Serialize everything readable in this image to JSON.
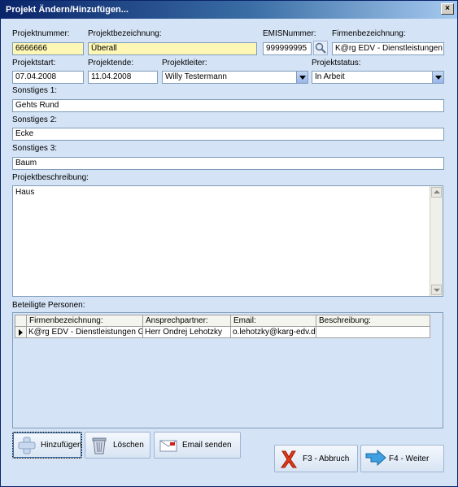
{
  "window": {
    "title": "Projekt Ändern/Hinzufügen...",
    "close": "×"
  },
  "fields": {
    "projektnummer": {
      "label": "Projektnummer:",
      "value": "6666666"
    },
    "projektbezeichnung": {
      "label": "Projektbezeichnung:",
      "value": "Überall"
    },
    "emisnummer": {
      "label": "EMISNummer:",
      "value": "999999995"
    },
    "firmenbezeichnung": {
      "label": "Firmenbezeichnung:",
      "value": "K@rg EDV - Dienstleistungen G"
    },
    "projektstart": {
      "label": "Projektstart:",
      "value": "07.04.2008"
    },
    "projektende": {
      "label": "Projektende:",
      "value": "11.04.2008"
    },
    "projektleiter": {
      "label": "Projektleiter:",
      "value": "Willy Testermann"
    },
    "projektstatus": {
      "label": "Projektstatus:",
      "value": "In Arbeit"
    },
    "sonstiges1": {
      "label": "Sonstiges 1:",
      "value": "Gehts Rund"
    },
    "sonstiges2": {
      "label": "Sonstiges 2:",
      "value": "Ecke"
    },
    "sonstiges3": {
      "label": "Sonstiges 3:",
      "value": "Baum"
    },
    "beschreibung": {
      "label": "Projektbeschreibung:",
      "value": "Haus"
    }
  },
  "persons": {
    "label": "Beteiligte Personen:",
    "columns": [
      "Firmenbezeichnung:",
      "Ansprechpartner:",
      "Email:",
      "Beschreibung:"
    ],
    "rows": [
      [
        "K@rg EDV - Dienstleistungen Gr",
        "Herr Ondrej Lehotzky",
        "o.lehotzky@karg-edv.de",
        ""
      ]
    ]
  },
  "buttons": {
    "add": "Hinzufügen",
    "delete": "Löschen",
    "email": "Email senden",
    "cancel": "F3 - Abbruch",
    "next": "F4 - Weiter"
  },
  "colors": {
    "window_bg": "#d4e3f5",
    "titlebar": "#0a246a",
    "highlight_field": "#fdf6b5"
  }
}
